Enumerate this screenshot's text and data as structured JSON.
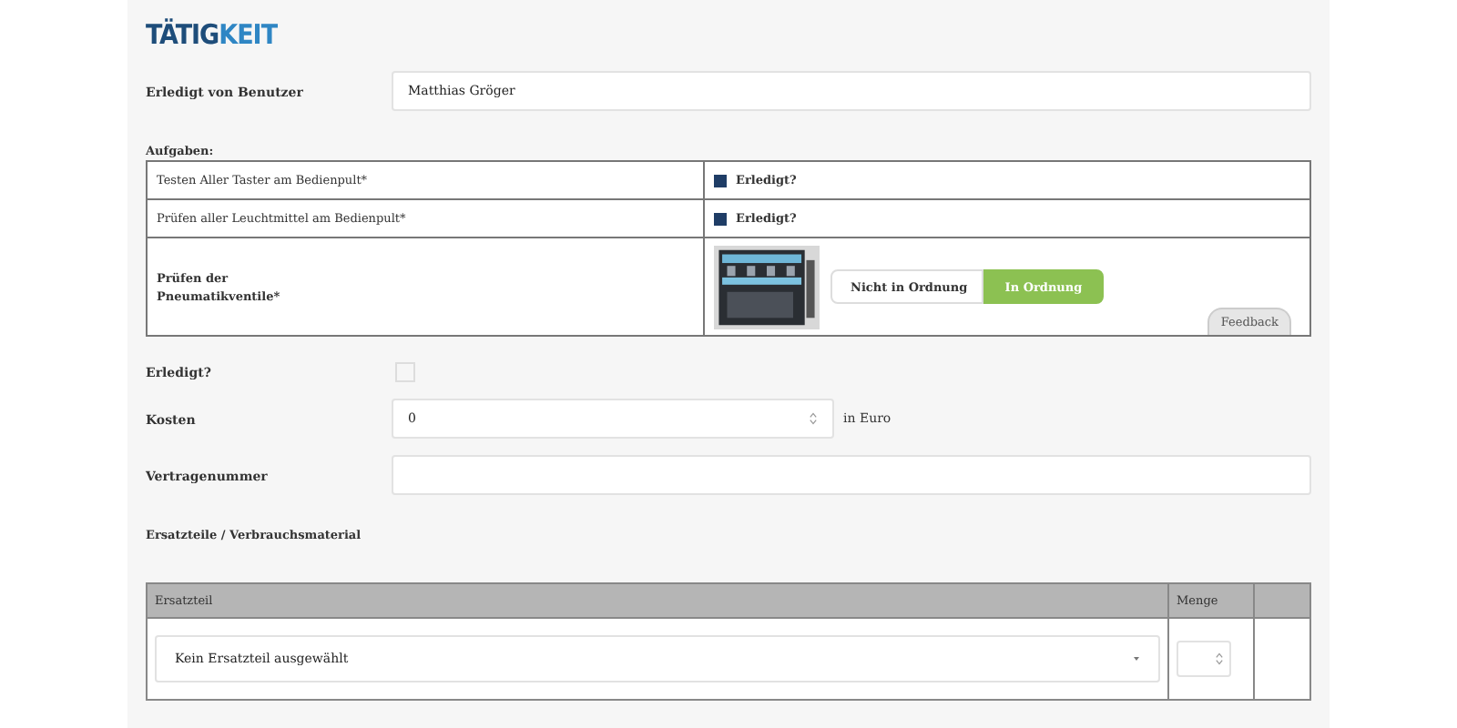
{
  "title_parts": [
    "TÄTIG",
    "KEIT"
  ],
  "user": {
    "label": "Erledigt von Benutzer",
    "value": "Matthias Gröger"
  },
  "tasks": {
    "label": "Aufgaben:",
    "rows": [
      {
        "kind": "checkbox",
        "name": "Testen Aller Taster am Bedienpult*",
        "checkbox_label": "Erledigt?",
        "checked": true
      },
      {
        "kind": "checkbox",
        "name": "Prüfen aller Leuchtmittel am Bedienpult*",
        "checkbox_label": "Erledigt?",
        "checked": true
      },
      {
        "kind": "rating",
        "name": "Prüfen der Pneumatikventile*",
        "image": {
          "kind": "picture"
        },
        "options": [
          {
            "label": "Nicht in Ordnung",
            "selected": false
          },
          {
            "label": "In Ordnung",
            "selected": true
          }
        ],
        "feedback": "Feedback"
      }
    ]
  },
  "done": {
    "label": "Erledigt?",
    "checked": false
  },
  "costs": {
    "label": "Kosten",
    "value": "0",
    "unit": "in Euro"
  },
  "contract": {
    "label": "Vertragenummer"
  },
  "parts": {
    "label": "Ersatzteile / Verbrauchsmaterial",
    "columns": [
      "Ersatzteil",
      "Menge"
    ],
    "rows": [
      {
        "part": "Kein Ersatzteil ausgewählt"
      }
    ]
  }
}
